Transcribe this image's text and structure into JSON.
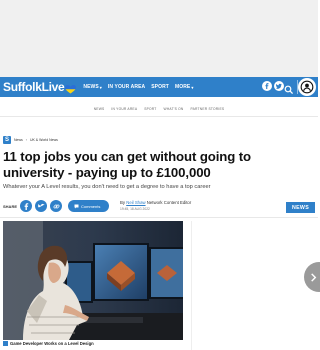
{
  "site": {
    "logo_text": "SuffolkLive",
    "brand_color": "#2f80c9"
  },
  "nav": {
    "items": [
      {
        "label": "NEWS",
        "has_dropdown": true
      },
      {
        "label": "IN YOUR AREA",
        "has_dropdown": false
      },
      {
        "label": "SPORT",
        "has_dropdown": false
      },
      {
        "label": "MORE",
        "has_dropdown": true
      }
    ],
    "icons": [
      "facebook-icon",
      "twitter-icon",
      "search-icon",
      "account-icon"
    ]
  },
  "subnav": {
    "items": [
      "NEWS",
      "IN YOUR AREA",
      "SPORT",
      "WHAT'S ON",
      "PARTNER STORIES"
    ]
  },
  "breadcrumb": {
    "items": [
      "News",
      "UK & World News"
    ]
  },
  "article": {
    "headline": "11 top jobs you can get without going to university - paying up to £100,000",
    "standfirst": "Whatever your A Level results, you don't need to get a degree to have a top career",
    "share_label": "SHARE",
    "comments_label": "Comments",
    "byline_prefix": "By",
    "author": "Neil Shaw",
    "author_role": "Network Content Editor",
    "date": "19:45, 18 AUG 2022",
    "category_badge": "NEWS",
    "image_caption": "Game Developer Works on a Level Design"
  }
}
